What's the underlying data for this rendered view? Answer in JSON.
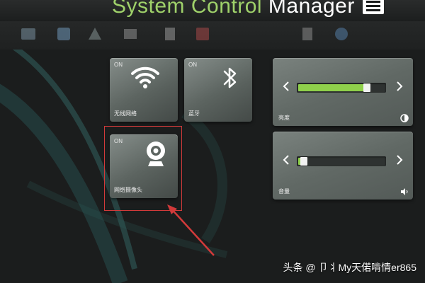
{
  "app": {
    "title_main": "System Control ",
    "title_accent": "Manager",
    "menu_icon": "menu-list-icon"
  },
  "toolbar": {
    "icons": [
      "app-icon-1",
      "app-icon-2",
      "app-icon-3",
      "app-icon-4",
      "app-icon-5",
      "app-icon-6",
      "app-icon-7",
      "app-icon-8"
    ]
  },
  "tiles": {
    "wifi": {
      "status": "ON",
      "label": "无线网络",
      "icon": "wifi-icon"
    },
    "bluetooth": {
      "status": "ON",
      "label": "蓝牙",
      "icon": "bluetooth-icon"
    },
    "camera": {
      "status": "ON",
      "label": "网络摄像头",
      "icon": "webcam-icon"
    }
  },
  "brightness": {
    "label": "亮度",
    "level": 0.85,
    "icon": "brightness-icon"
  },
  "volume": {
    "label": "音量",
    "level": 0.12,
    "icon": "speaker-icon"
  },
  "watermark": {
    "text": "头条 @ 卩丬My天偌啃情er865"
  },
  "colors": {
    "accent_green": "#8fd04b",
    "title_green": "#9fd16a",
    "highlight_red": "#d23a3a"
  }
}
